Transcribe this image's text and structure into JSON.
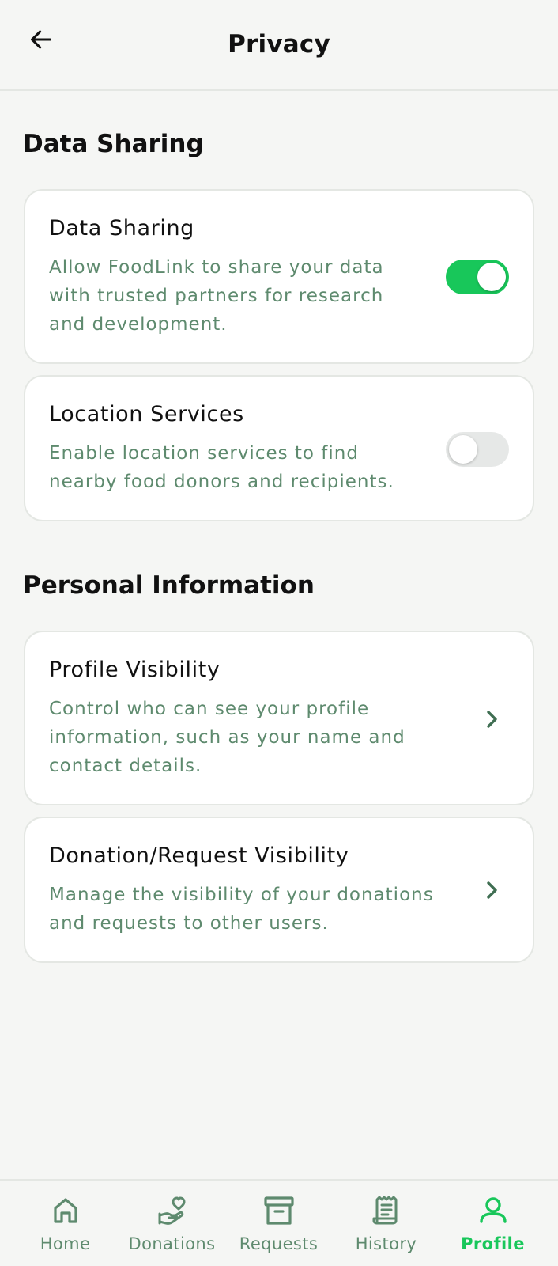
{
  "header": {
    "title": "Privacy",
    "back_icon": "arrow-left-icon"
  },
  "sections": {
    "data_sharing": {
      "title": "Data Sharing",
      "items": [
        {
          "title": "Data Sharing",
          "description_lines": [
            "Allow FoodLink to share your data",
            "with trusted partners for research",
            "and development."
          ],
          "toggle": "on"
        },
        {
          "title": "Location Services",
          "description_lines": [
            "Enable location services to find",
            "nearby food donors and recipients."
          ],
          "toggle": "off"
        }
      ]
    },
    "personal_info": {
      "title": "Personal Information",
      "items": [
        {
          "title": "Profile Visibility",
          "description_lines": [
            "Control who can see your profile",
            "information, such as your name and",
            "contact details."
          ],
          "icon": "chevron-right-icon"
        },
        {
          "title": "Donation/Request Visibility",
          "description_lines": [
            "Manage the visibility of your donations",
            "and requests to other users."
          ],
          "icon": "chevron-right-icon"
        }
      ]
    }
  },
  "tabbar": {
    "tabs": [
      {
        "label": "Home",
        "icon": "home-icon",
        "active": false
      },
      {
        "label": "Donations",
        "icon": "hand-heart-icon",
        "active": false
      },
      {
        "label": "Requests",
        "icon": "archive-box-icon",
        "active": false
      },
      {
        "label": "History",
        "icon": "receipt-icon",
        "active": false
      },
      {
        "label": "Profile",
        "icon": "user-icon",
        "active": true
      }
    ]
  },
  "colors": {
    "accent": "#18c75a",
    "muted_text": "#5e8a6e",
    "background": "#f5f6f4",
    "card": "#ffffff",
    "border": "#e4e7e3"
  }
}
